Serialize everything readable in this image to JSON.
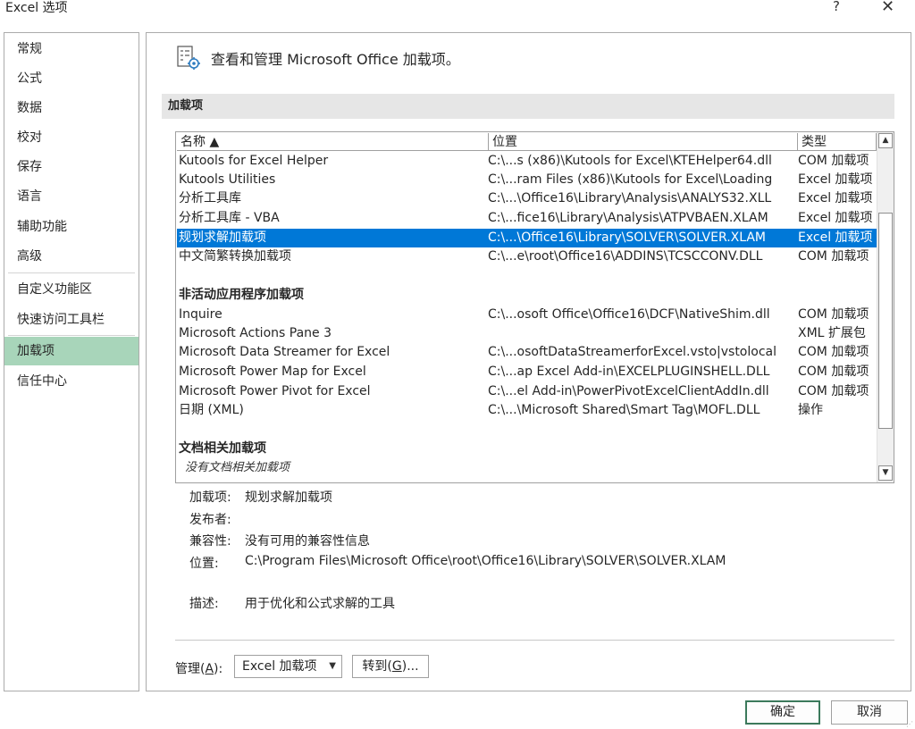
{
  "window": {
    "title": "Excel 选项",
    "help_label": "?",
    "close_label": "✕"
  },
  "sidebar": {
    "items": [
      {
        "label": "常规"
      },
      {
        "label": "公式"
      },
      {
        "label": "数据"
      },
      {
        "label": "校对"
      },
      {
        "label": "保存"
      },
      {
        "label": "语言"
      },
      {
        "label": "辅助功能"
      },
      {
        "label": "高级"
      },
      {
        "label": "自定义功能区"
      },
      {
        "label": "快速访问工具栏"
      },
      {
        "label": "加载项",
        "selected": true
      },
      {
        "label": "信任中心"
      }
    ]
  },
  "header": {
    "text": "查看和管理 Microsoft Office 加载项。"
  },
  "section": {
    "title": "加载项"
  },
  "table": {
    "columns": [
      "名称 ▲",
      "位置",
      "类型"
    ],
    "active_rows": [
      {
        "name": "Kutools for Excel Helper",
        "location": "C:\\...s (x86)\\Kutools for Excel\\KTEHelper64.dll",
        "type": "COM 加载项"
      },
      {
        "name": "Kutools Utilities",
        "location": "C:\\...ram Files (x86)\\Kutools for Excel\\Loading",
        "type": "Excel 加载项"
      },
      {
        "name": "分析工具库",
        "location": "C:\\...\\Office16\\Library\\Analysis\\ANALYS32.XLL",
        "type": "Excel 加载项"
      },
      {
        "name": "分析工具库 - VBA",
        "location": "C:\\...fice16\\Library\\Analysis\\ATPVBAEN.XLAM",
        "type": "Excel 加载项"
      },
      {
        "name": "规划求解加载项",
        "location": "C:\\...\\Office16\\Library\\SOLVER\\SOLVER.XLAM",
        "type": "Excel 加载项",
        "selected": true
      },
      {
        "name": "中文简繁转换加载项",
        "location": "C:\\...e\\root\\Office16\\ADDINS\\TCSCCONV.DLL",
        "type": "COM 加载项"
      }
    ],
    "inactive_group_title": "非活动应用程序加载项",
    "inactive_rows": [
      {
        "name": "Inquire",
        "location": "C:\\...osoft Office\\Office16\\DCF\\NativeShim.dll",
        "type": "COM 加载项"
      },
      {
        "name": "Microsoft Actions Pane 3",
        "location": "",
        "type": "XML 扩展包"
      },
      {
        "name": "Microsoft Data Streamer for Excel",
        "location": "C:\\...osoftDataStreamerforExcel.vsto|vstolocal",
        "type": "COM 加载项"
      },
      {
        "name": "Microsoft Power Map for Excel",
        "location": "C:\\...ap Excel Add-in\\EXCELPLUGINSHELL.DLL",
        "type": "COM 加载项"
      },
      {
        "name": "Microsoft Power Pivot for Excel",
        "location": "C:\\...el Add-in\\PowerPivotExcelClientAddIn.dll",
        "type": "COM 加载项"
      },
      {
        "name": "日期 (XML)",
        "location": "C:\\...\\Microsoft Shared\\Smart Tag\\MOFL.DLL",
        "type": "操作"
      }
    ],
    "doc_group_title": "文档相关加载项",
    "doc_empty_text": "没有文档相关加载项"
  },
  "details": {
    "addin_label": "加载项:",
    "addin_value": "规划求解加载项",
    "publisher_label": "发布者:",
    "publisher_value": "",
    "compat_label": "兼容性:",
    "compat_value": "没有可用的兼容性信息",
    "location_label": "位置:",
    "location_value": "C:\\Program Files\\Microsoft Office\\root\\Office16\\Library\\SOLVER\\SOLVER.XLAM",
    "desc_label": "描述:",
    "desc_value": "用于优化和公式求解的工具"
  },
  "manage": {
    "label_prefix": "管理(",
    "label_key": "A",
    "label_suffix": "):",
    "selected": "Excel 加载项",
    "goto_prefix": "转到(",
    "goto_key": "G",
    "goto_suffix": ")..."
  },
  "buttons": {
    "ok": "确定",
    "cancel": "取消"
  },
  "colors": {
    "nav_selected": "#a8d5ba",
    "row_selected": "#0078d7"
  }
}
